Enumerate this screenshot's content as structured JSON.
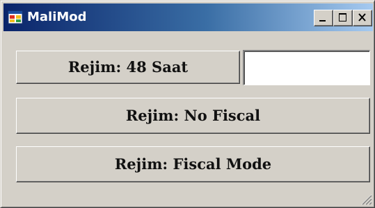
{
  "window": {
    "title": "MaliMod",
    "icon": "application-icon"
  },
  "caption_buttons": {
    "minimize": "minimize-icon",
    "maximize": "maximize-icon",
    "close": "close-icon"
  },
  "buttons": {
    "mode_48": "Rejim: 48 Saat",
    "no_fiscal": "Rejim: No Fiscal",
    "fiscal_mode": "Rejim: Fiscal Mode"
  },
  "input": {
    "value": ""
  },
  "colors": {
    "face": "#d4d0c8",
    "title_start": "#0a246a",
    "title_end": "#a6caf0"
  }
}
